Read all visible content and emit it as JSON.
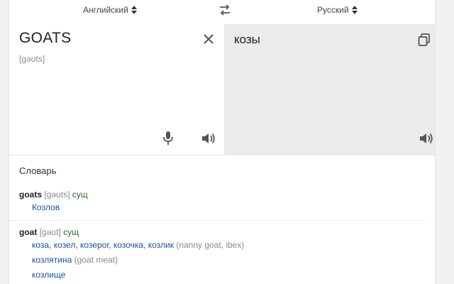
{
  "languages": {
    "source": "Английский",
    "target": "Русский"
  },
  "source": {
    "text": "GOATS",
    "transliteration": "[ɡəʊts]"
  },
  "target": {
    "text": "козы"
  },
  "dictionary": {
    "title": "Словарь",
    "entries": [
      {
        "word": "goats",
        "transcription": "[ɡəʊts]",
        "pos": "сущ",
        "lines": [
          {
            "translations": "Козлов",
            "gloss": ""
          }
        ]
      },
      {
        "word": "goat",
        "transcription": "[ɡəʊt]",
        "pos": "сущ",
        "lines": [
          {
            "translations": "коза, козел, козерог, козочка, козлик",
            "gloss": "(nanny goat, ibex)"
          },
          {
            "translations": "козлятина",
            "gloss": "(goat meat)"
          },
          {
            "translations": "козлище",
            "gloss": ""
          }
        ]
      }
    ]
  },
  "colors": {
    "target_pane": "#ebebeb",
    "link_blue": "#1a4f9c",
    "pos_green": "#2e6b2f"
  }
}
